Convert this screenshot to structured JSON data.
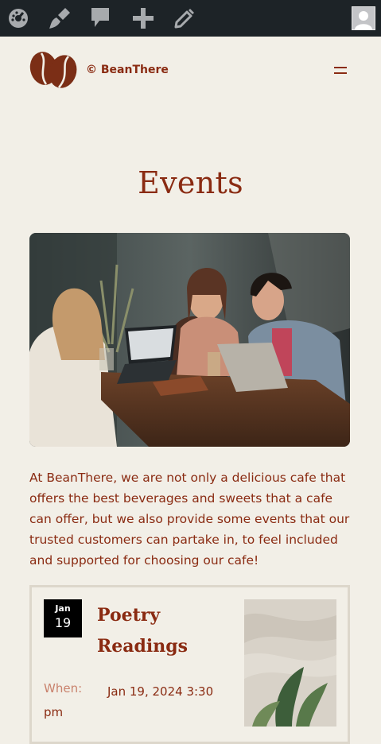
{
  "admin_bar": {
    "icons": [
      "dashboard-icon",
      "customize-brush-icon",
      "comments-icon",
      "new-content-icon",
      "edit-icon"
    ],
    "avatar": "user-avatar-icon"
  },
  "header": {
    "site_title": "© BeanThere",
    "logo": "coffee-beans-logo",
    "menu_icon": "hamburger-menu-icon"
  },
  "page": {
    "title": "Events",
    "hero_image": "friends-with-laptops-in-cafe-photo",
    "intro": "At BeanThere, we are not only a delicious cafe that offers the best beverages and sweets that a cafe can offer, but we also provide some events that our trusted customers can partake in, to feel included and supported for choosing our cafe!"
  },
  "event": {
    "month": "Jan",
    "day": "19",
    "title": "Poetry Readings",
    "when_label": "When:",
    "when_value": "Jan 19, 2024 3:30 pm",
    "image": "plant-leaves-photo"
  },
  "colors": {
    "accent": "#8a2b12",
    "background": "#f2efe7",
    "admin_bar": "#1d2327"
  }
}
